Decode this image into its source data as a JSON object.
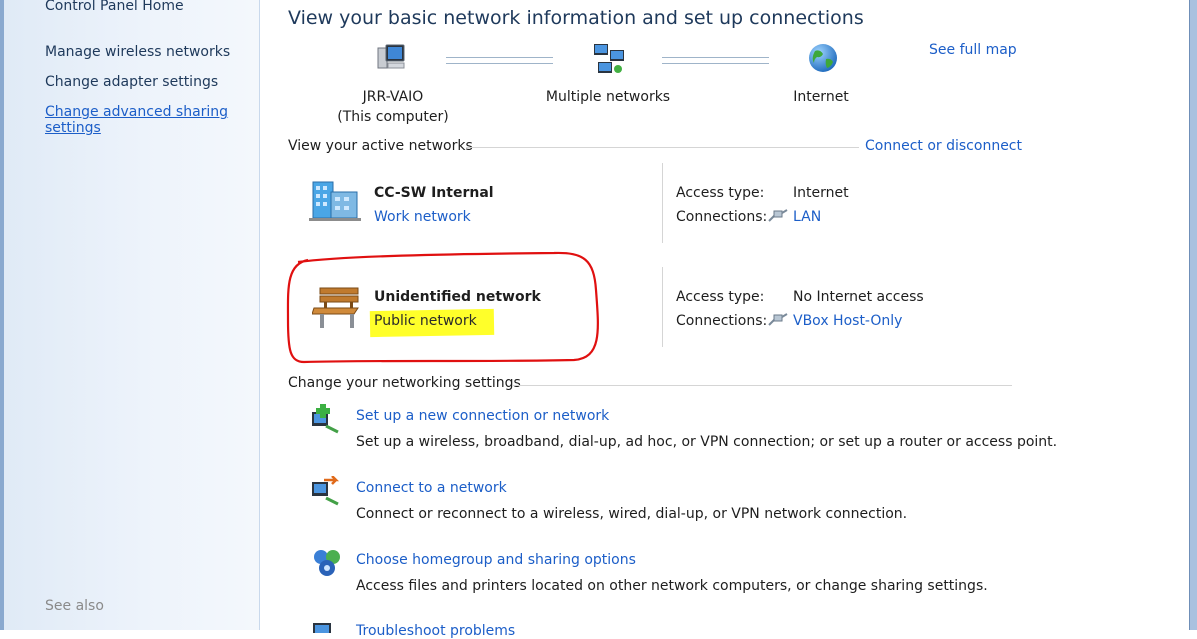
{
  "sidebar": {
    "home": "Control Panel Home",
    "items": [
      {
        "label": "Manage wireless networks"
      },
      {
        "label": "Change adapter settings"
      },
      {
        "label_line1": "Change advanced sharing",
        "label_line2": "settings"
      }
    ],
    "see_also": "See also"
  },
  "header": {
    "title": "View your basic network information and set up connections"
  },
  "map": {
    "computer_name": "JRR-VAIO",
    "computer_sub": "(This computer)",
    "middle": "Multiple networks",
    "internet": "Internet",
    "see_full_map": "See full map"
  },
  "active": {
    "heading": "View your active networks",
    "connect_link": "Connect or disconnect",
    "networks": [
      {
        "name": "CC-SW Internal",
        "type": "Work network",
        "access_label": "Access type:",
        "access_value": "Internet",
        "conn_label": "Connections:",
        "conn_value": "LAN"
      },
      {
        "name": "Unidentified network",
        "type": "Public network",
        "access_label": "Access type:",
        "access_value": "No Internet access",
        "conn_label": "Connections:",
        "conn_value": "VBox Host-Only"
      }
    ]
  },
  "settings": {
    "heading": "Change your networking settings",
    "tasks": [
      {
        "title": "Set up a new connection or network",
        "desc": "Set up a wireless, broadband, dial-up, ad hoc, or VPN connection; or set up a router or access point."
      },
      {
        "title": "Connect to a network",
        "desc": "Connect or reconnect to a wireless, wired, dial-up, or VPN network connection."
      },
      {
        "title": "Choose homegroup and sharing options",
        "desc": "Access files and printers located on other network computers, or change sharing settings."
      },
      {
        "title": "Troubleshoot problems"
      }
    ]
  },
  "colors": {
    "link": "#1c5ec8",
    "title": "#1e395b",
    "highlight": "#ffff2a",
    "annotation": "#e01010"
  },
  "icons": [
    "computer-icon",
    "network-icon",
    "globe-icon",
    "building-icon",
    "bench-icon",
    "cable-icon",
    "new-connection-icon",
    "connect-icon",
    "homegroup-icon",
    "troubleshoot-icon"
  ]
}
